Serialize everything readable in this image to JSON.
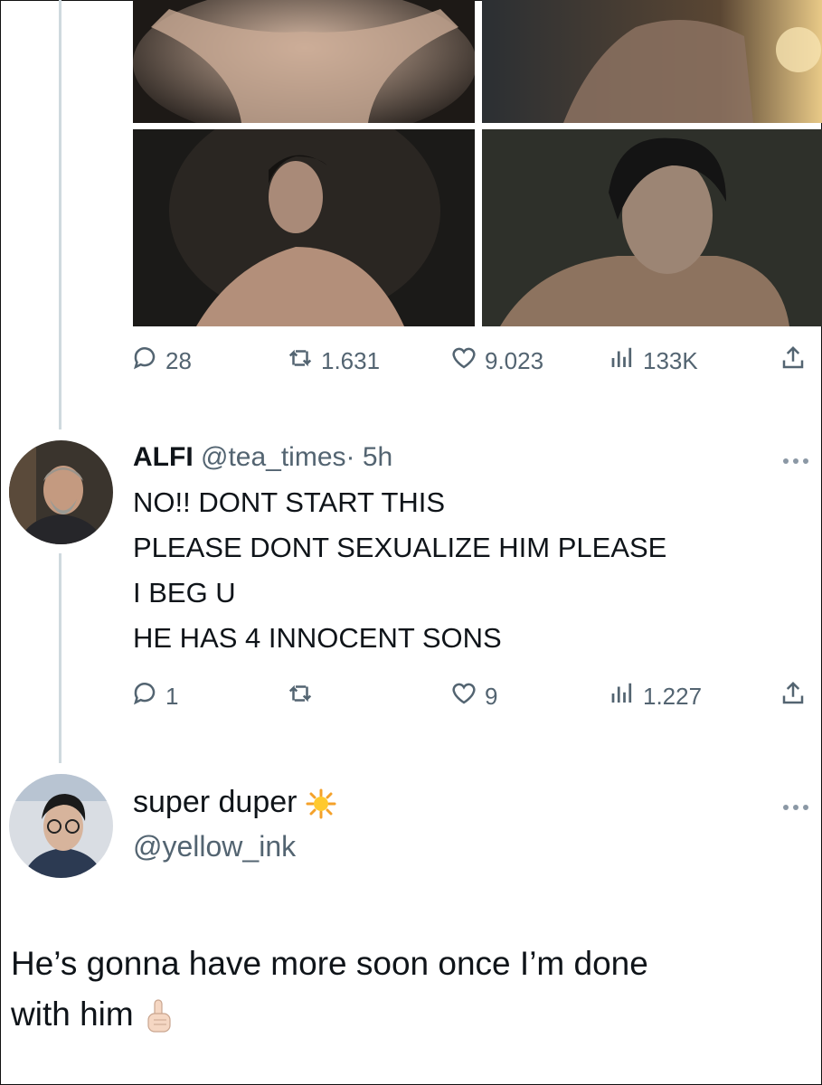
{
  "tweet1": {
    "stats": {
      "replies": "28",
      "retweets": "1.631",
      "likes": "9.023",
      "views": "133K"
    }
  },
  "tweet2": {
    "display_name": "ALFI",
    "handle": "@tea_times",
    "separator": "·",
    "time": "5h",
    "lines": [
      "NO!! DONT START THIS",
      "PLEASE DONT SEXUALIZE HIM PLEASE",
      "I BEG U",
      "HE HAS 4 INNOCENT SONS"
    ],
    "stats": {
      "replies": "1",
      "retweets": "",
      "likes": "9",
      "views": "1.227"
    }
  },
  "tweet3": {
    "display_name": "super duper",
    "handle": "@yellow_ink",
    "text_line1": "He’s gonna have more soon once I’m done",
    "text_line2": "with him"
  },
  "icons": {
    "reply": "reply-icon",
    "retweet": "retweet-icon",
    "like": "heart-icon",
    "views": "views-icon",
    "share": "share-icon",
    "more": "more-icon",
    "sun_emoji": "sun-emoji-icon",
    "finger_emoji": "pointing-up-emoji-icon"
  },
  "colors": {
    "icon_gray": "#536471",
    "text": "#0f1419",
    "thread_line": "#cfd9de"
  }
}
